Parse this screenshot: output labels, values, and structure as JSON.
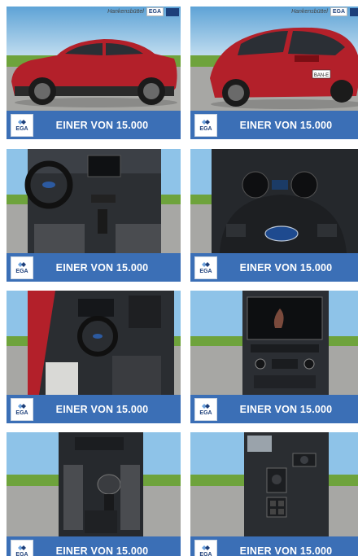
{
  "banner_text": "EINER VON 15.000",
  "logo_text": "EGA",
  "dealer_name": "Hankensbüttel",
  "plate_text": "BAN-E",
  "tiles": [
    {
      "subject": "car-exterior-side",
      "dealer": true
    },
    {
      "subject": "car-exterior-rear",
      "dealer": true
    },
    {
      "subject": "car-interior-dashboard"
    },
    {
      "subject": "steering-wheel-closeup"
    },
    {
      "subject": "car-interior-door-view"
    },
    {
      "subject": "infotainment-screen"
    },
    {
      "subject": "gear-shift"
    },
    {
      "subject": "door-controls"
    }
  ],
  "colors": {
    "banner": "#3b6fb6",
    "car_red": "#b3202a",
    "sky": "#8ec3e8",
    "grass": "#6ea33c"
  }
}
